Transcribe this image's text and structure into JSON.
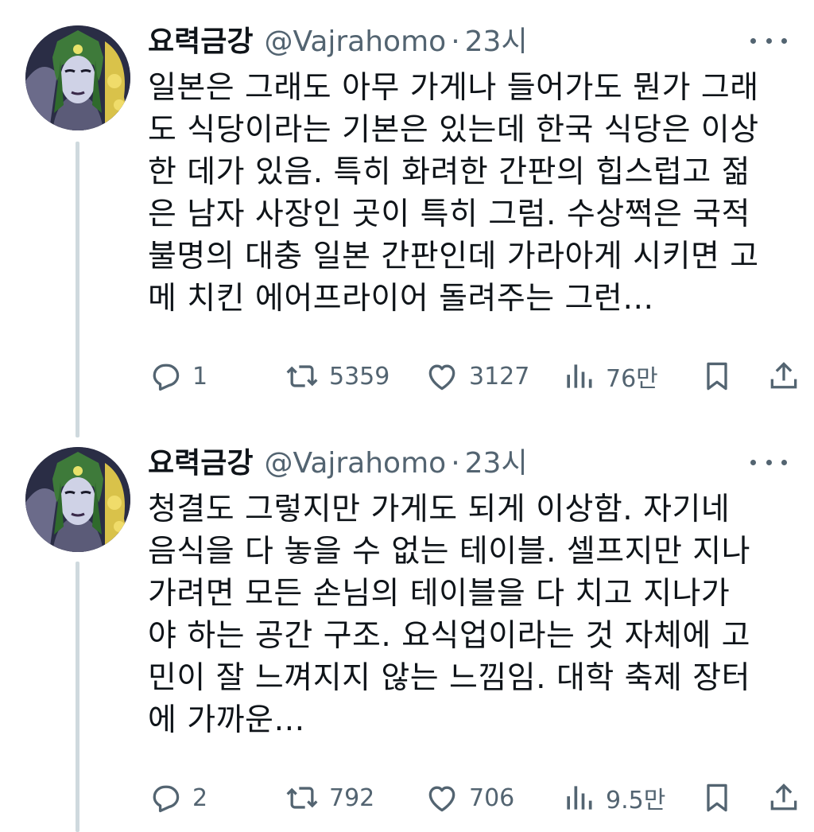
{
  "tweets": [
    {
      "name": "요력금강",
      "handle": "@Vajrahomo",
      "separator": "·",
      "time": "23시",
      "lines": [
        "일본은 그래도 아무 가게나 들어가도 뭔가 그래",
        "도 식당이라는 기본은 있는데 한국 식당은 이상",
        "한 데가 있음. 특히 화려한 간판의 힙스럽고 젊",
        "은 남자 사장인 곳이 특히 그럼. 수상쩍은 국적",
        "불명의 대충 일본 간판인데 가라아게 시키면 고",
        "메 치킨 에어프라이어 돌려주는 그런…"
      ],
      "stats": {
        "replies": "1",
        "retweets": "5359",
        "likes": "3127",
        "views": "76만"
      }
    },
    {
      "name": "요력금강",
      "handle": "@Vajrahomo",
      "separator": "·",
      "time": "23시",
      "lines": [
        "청결도 그렇지만 가게도 되게 이상함. 자기네",
        "음식을 다 놓을 수 없는 테이블. 셀프지만 지나",
        "가려면 모든 손님의 테이블을 다 치고 지나가",
        "야 하는 공간 구조. 요식업이라는 것 자체에 고",
        "민이 잘 느껴지지 않는 느낌임. 대학 축제 장터",
        "에 가까운…"
      ],
      "stats": {
        "replies": "2",
        "retweets": "792",
        "likes": "706",
        "views": "9.5만"
      }
    }
  ],
  "icons": {
    "reply": "reply-icon",
    "retweet": "retweet-icon",
    "like": "heart-icon",
    "views": "views-icon",
    "bookmark": "bookmark-icon",
    "share": "share-icon",
    "more": "more-icon"
  },
  "colors": {
    "text": "#0f1419",
    "secondary": "#536471",
    "thread_line": "#cfd9de",
    "background": "#ffffff"
  }
}
